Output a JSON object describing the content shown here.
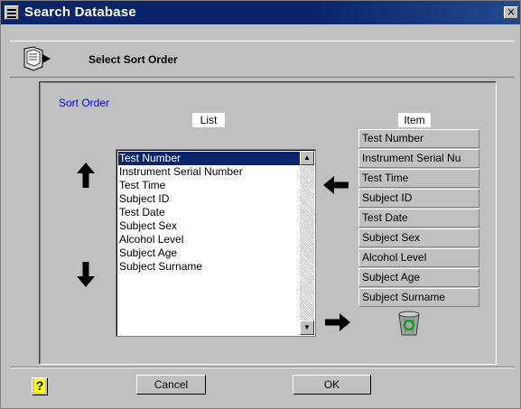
{
  "window": {
    "title": "Search Database",
    "close_glyph": "×"
  },
  "header": {
    "title": "Select Sort Order",
    "icon": "database-arrow-icon"
  },
  "sort": {
    "group_label": "Sort Order",
    "list_caption": "List",
    "item_caption": "Item",
    "list_items": [
      "Test Number",
      "Instrument Serial Number",
      "Test Time",
      "Subject ID",
      "Test Date",
      "Subject Sex",
      "Alcohol Level",
      "Subject Age",
      "Subject Surname"
    ],
    "selected_index": 0,
    "items": [
      "Test Number",
      "Instrument Serial Nu",
      "Test Time",
      "Subject ID",
      "Test Date",
      "Subject Sex",
      "Alcohol Level",
      "Subject Age",
      "Subject Surname"
    ]
  },
  "buttons": {
    "help": "?",
    "cancel": "Cancel",
    "ok": "OK"
  },
  "colors": {
    "titlebar": "#0a246a",
    "selection": "#0a246a",
    "group_label": "#0000ff",
    "face": "#c0c0c0"
  }
}
